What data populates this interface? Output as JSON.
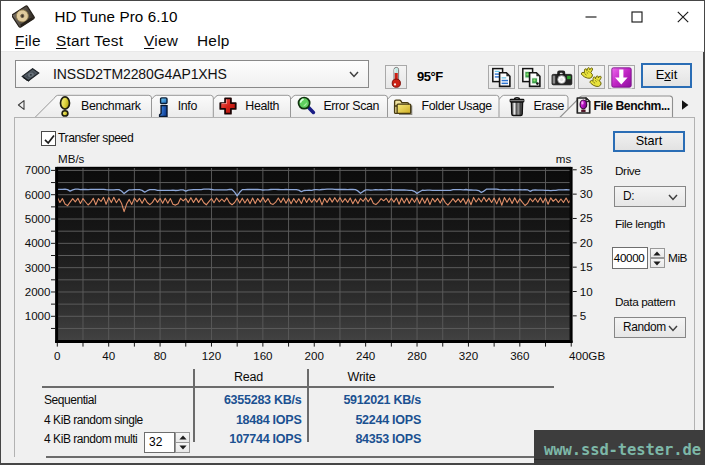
{
  "window": {
    "title": "HD Tune Pro 6.10"
  },
  "menu": {
    "items": [
      {
        "pre": "",
        "u": "F",
        "post": "ile"
      },
      {
        "pre": "",
        "u": "S",
        "post": "tart Test"
      },
      {
        "pre": "",
        "u": "V",
        "post": "iew"
      },
      {
        "pre": "Help",
        "u": "",
        "post": ""
      }
    ]
  },
  "toolbar": {
    "device": "INSSD2TM2280G4AP1XHS",
    "temperature": "95°F",
    "exit_label": {
      "pre": "E",
      "u": "x",
      "post": "it"
    },
    "button_icons": [
      "thermometer-icon",
      "copy-text-icon",
      "copy-image-icon",
      "camera-icon",
      "hands-icon",
      "download-icon"
    ]
  },
  "tabs": [
    {
      "label": "Benchmark",
      "icon": "bulb-icon",
      "active": false
    },
    {
      "label": "Info",
      "icon": "info-icon",
      "active": false
    },
    {
      "label": "Health",
      "icon": "health-icon",
      "active": false
    },
    {
      "label": "Error Scan",
      "icon": "magnifier-icon",
      "active": false
    },
    {
      "label": "Folder Usage",
      "icon": "folder-icon",
      "active": false
    },
    {
      "label": "Erase",
      "icon": "trash-icon",
      "active": false
    },
    {
      "label": "File Benchm...",
      "icon": "file-bulb-icon",
      "active": true
    }
  ],
  "panel": {
    "transfer_speed_label": "Transfer speed",
    "transfer_speed_checked": true
  },
  "controls": {
    "start": "Start",
    "drive_label": "Drive",
    "drive_value": "D:",
    "file_length_label": "File length",
    "file_length_value": "40000",
    "file_length_unit": "MiB",
    "data_pattern_label": "Data pattern",
    "data_pattern_value": "Random",
    "thread_count": "32"
  },
  "results": {
    "col_read": "Read",
    "col_write": "Write",
    "rows": [
      {
        "label": "Sequential",
        "read": "6355283 KB/s",
        "write": "5912021 KB/s"
      },
      {
        "label": "4 KiB random single",
        "read": "18484 IOPS",
        "write": "52244 IOPS"
      },
      {
        "label": "4 KiB random multi",
        "read": "107744 IOPS",
        "write": "84353 IOPS"
      }
    ]
  },
  "watermark": {
    "text": "www.ssd-tester.de"
  },
  "colors": {
    "accent_focus": "#2a6db5",
    "value_blue": "#1b5191",
    "temp_blue": "#2b52cc",
    "read_line": "#8fa9da",
    "write_line": "#e08f69",
    "watermark_teal": "#7db8a8",
    "watermark_bg": "#3d3d3d"
  },
  "chart_data": {
    "type": "line",
    "x_axis": {
      "unit": "GB",
      "range": [
        0,
        400
      ],
      "tick_step_labeled": 40,
      "tick_step_minor": 20,
      "last_label": "400GB"
    },
    "y_left": {
      "unit": "MB/s",
      "range": [
        0,
        7000
      ],
      "label_step": 1000,
      "grid_step": 500
    },
    "y_right": {
      "unit": "ms",
      "range": [
        0,
        35
      ],
      "label_step": 5
    },
    "x_step_gb": 2,
    "series": [
      {
        "name": "read",
        "color": "#8fa9da",
        "values": [
          6219,
          6224,
          6222,
          6228,
          6212,
          6150,
          6196,
          6227,
          6227,
          6208,
          6216,
          6214,
          6210,
          6222,
          6220,
          6218,
          6223,
          6224,
          6222,
          6205,
          6199,
          6201,
          6203,
          6210,
          6205,
          6152,
          6045,
          6135,
          6203,
          6202,
          6208,
          6207,
          6205,
          6178,
          6105,
          6165,
          6206,
          6206,
          6205,
          6181,
          6179,
          6177,
          6181,
          6179,
          6176,
          6184,
          6175,
          6182,
          6203,
          6200,
          6148,
          6187,
          6197,
          6210,
          6209,
          6210,
          6209,
          6227,
          6226,
          6225,
          6215,
          6199,
          6199,
          6198,
          6198,
          6201,
          6199,
          6224,
          6214,
          6106,
          5950,
          6098,
          6212,
          6212,
          6216,
          6216,
          6218,
          6213,
          6215,
          6210,
          6194,
          6199,
          6197,
          6213,
          6217,
          6217,
          6214,
          6211,
          6209,
          6214,
          6211,
          6207,
          6212,
          6211,
          6189,
          6125,
          6174,
          6180,
          6184,
          6183,
          6210,
          6206,
          6202,
          6214,
          6218,
          6226,
          6229,
          6227,
          6221,
          6214,
          6215,
          6214,
          6219,
          6210,
          6217,
          6215,
          6208,
          6158,
          6060,
          6135,
          6196,
          6196,
          6190,
          6199,
          6210,
          6203,
          6209,
          6203,
          6203,
          6208,
          6210,
          6194,
          6196,
          6194,
          6194,
          6194,
          6189,
          6181,
          6180,
          6140,
          6052,
          6126,
          6184,
          6182,
          6187,
          6184,
          6179,
          6180,
          6178,
          6177,
          6182,
          6180,
          6182,
          6181,
          6209,
          6206,
          6210,
          6205,
          6203,
          6213,
          6193,
          6192,
          6189,
          6190,
          6168,
          6092,
          6150,
          6227,
          6230,
          6225,
          6230,
          6231,
          6205,
          6201,
          6209,
          6203,
          6202,
          6207,
          6200,
          6200,
          6205,
          6202,
          6207,
          6202,
          6140,
          6184,
          6200,
          6187,
          6190,
          6184,
          6181,
          6178,
          6171,
          6182,
          6182,
          6202,
          6202,
          6199,
          6208,
          6200,
          6202
        ]
      },
      {
        "name": "write",
        "color": "#e08f69",
        "values": [
          5892,
          5680,
          5839,
          5618,
          5554,
          5693,
          5838,
          5704,
          5854,
          5638,
          5839,
          5700,
          5576,
          5683,
          5854,
          5589,
          5842,
          5719,
          5891,
          5604,
          5880,
          5674,
          5895,
          5671,
          5834,
          5650,
          5302,
          5625,
          5807,
          5601,
          5861,
          5710,
          5848,
          5647,
          5855,
          5680,
          5589,
          5683,
          5858,
          5682,
          5843,
          5648,
          5851,
          5652,
          5839,
          5606,
          5572,
          5629,
          5851,
          5744,
          5843,
          5677,
          5876,
          5678,
          5861,
          5682,
          5853,
          5669,
          5585,
          5718,
          5845,
          5673,
          5864,
          5708,
          5825,
          5713,
          5869,
          5667,
          5584,
          5678,
          5856,
          5657,
          5855,
          5658,
          5830,
          5631,
          5860,
          5636,
          5845,
          5697,
          5882,
          5689,
          5839,
          5643,
          5602,
          5694,
          5864,
          5679,
          5866,
          5648,
          5846,
          5627,
          5846,
          5666,
          5836,
          5634,
          5895,
          5684,
          5856,
          5682,
          5841,
          5698,
          5866,
          5583,
          5849,
          5678,
          5868,
          5697,
          5876,
          5699,
          5876,
          5689,
          5841,
          5685,
          5863,
          5628,
          5827,
          5633,
          5845,
          5724,
          5879,
          5707,
          5870,
          5639,
          5592,
          5697,
          5837,
          5750,
          5852,
          5678,
          5851,
          5695,
          5863,
          5607,
          5866,
          5665,
          5862,
          5643,
          5854,
          5689,
          5873,
          5626,
          5868,
          5652,
          5866,
          5592,
          5849,
          5709,
          5847,
          5660,
          5866,
          5677,
          5574,
          5692,
          5841,
          5695,
          5826,
          5686,
          5848,
          5616,
          5838,
          5588,
          5890,
          5702,
          5858,
          5699,
          5895,
          5718,
          5862,
          5680,
          5865,
          5622,
          5870,
          5567,
          5882,
          5686,
          5866,
          5643,
          5879,
          5655,
          5832,
          5686,
          5558,
          5644,
          5843,
          5712,
          5856,
          5694,
          5873,
          5666,
          5869,
          5610,
          5871,
          5724,
          5826,
          5680,
          5823,
          5678,
          5863,
          5671,
          5845
        ]
      }
    ],
    "legend": null,
    "grid": true
  }
}
